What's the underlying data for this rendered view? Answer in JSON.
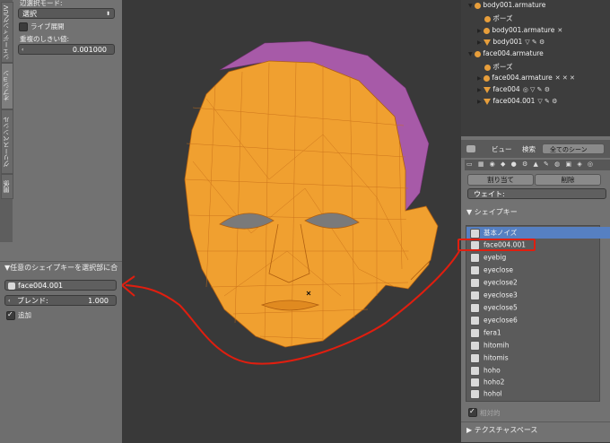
{
  "left": {
    "tabs": [
      "シェーディング/UV",
      "オプション",
      "グリースペンシル",
      "関係"
    ],
    "edge_select_label": "辺選択モード:",
    "select_dropdown": "選択",
    "live_unwrap": "ライブ展開",
    "weight_threshold_label": "重複のしきい値:",
    "threshold_value": "0.001000",
    "operator_title": "任意のシェイプキーを選択部に合",
    "shape_key_field": "face004.001",
    "blend_label": "ブレンド:",
    "blend_value": "1.000",
    "add_label": "追加"
  },
  "outliner": {
    "rows": [
      {
        "label": "body001.armature"
      },
      {
        "label": "ポーズ"
      },
      {
        "label": "body001.armature"
      },
      {
        "label": "body001"
      },
      {
        "label": "face004.armature"
      },
      {
        "label": "ポーズ"
      },
      {
        "label": "face004.armature"
      },
      {
        "label": "face004"
      },
      {
        "label": "face004.001"
      }
    ]
  },
  "props": {
    "header": {
      "view": "ビュー",
      "search": "検索",
      "scenes": "全てのシーン"
    },
    "assign": "割り当て",
    "delete": "削除",
    "weight_label": "ウェイト:",
    "shape_keys_title": "シェイプキー",
    "shape_keys": [
      "基本ノイズ",
      "face004.001",
      "eyebig",
      "eyeclose",
      "eyeclose2",
      "eyeclose3",
      "eyeclose5",
      "eyeclose6",
      "fera1",
      "hitomih",
      "hitomis",
      "hoho",
      "hoho2",
      "hohol"
    ],
    "relative": "相対的",
    "texture_space": "テクスチャスペース"
  },
  "colors": {
    "annotation": "#e01e0f",
    "mesh": "#f0a030",
    "purple": "#a055a0",
    "selected": "#5680c2"
  }
}
